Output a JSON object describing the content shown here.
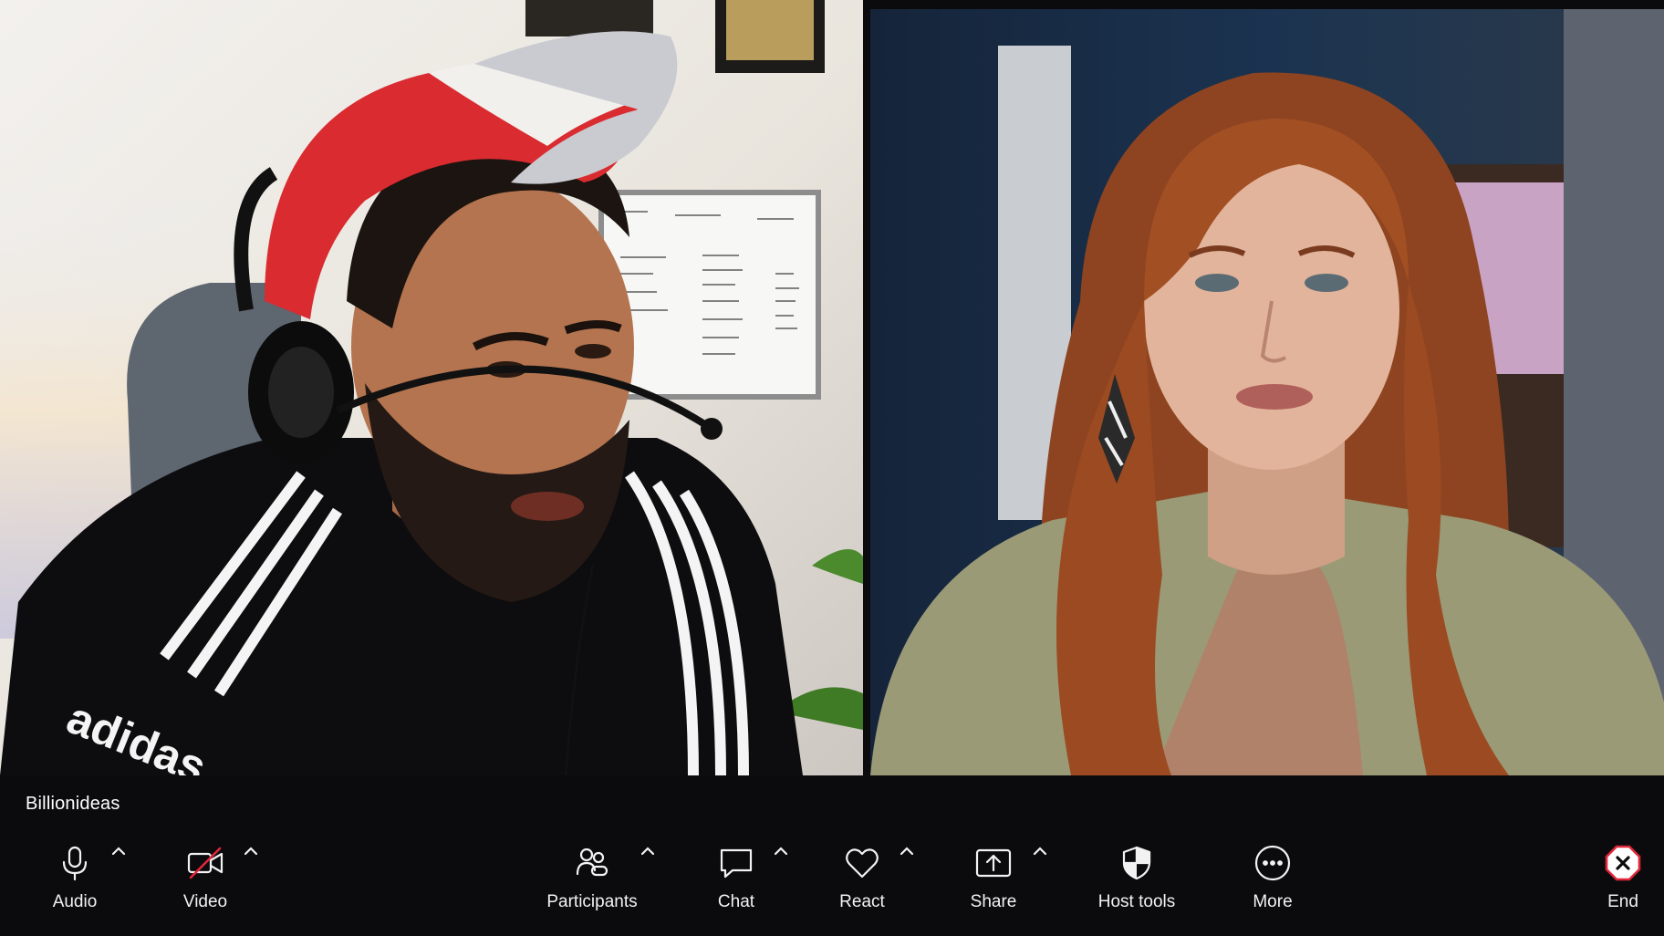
{
  "meeting": {
    "participant_label": "Billionideas"
  },
  "toolbar": {
    "audio_label": "Audio",
    "video_label": "Video",
    "participants_label": "Participants",
    "chat_label": "Chat",
    "react_label": "React",
    "share_label": "Share",
    "host_tools_label": "Host tools",
    "more_label": "More",
    "end_label": "End"
  },
  "video_state": {
    "video_muted": true
  },
  "colors": {
    "bar_background": "#0b0b0d",
    "icon": "#f2f2f2",
    "end_accent": "#e0263a",
    "video_off_slash": "#e0263a"
  }
}
